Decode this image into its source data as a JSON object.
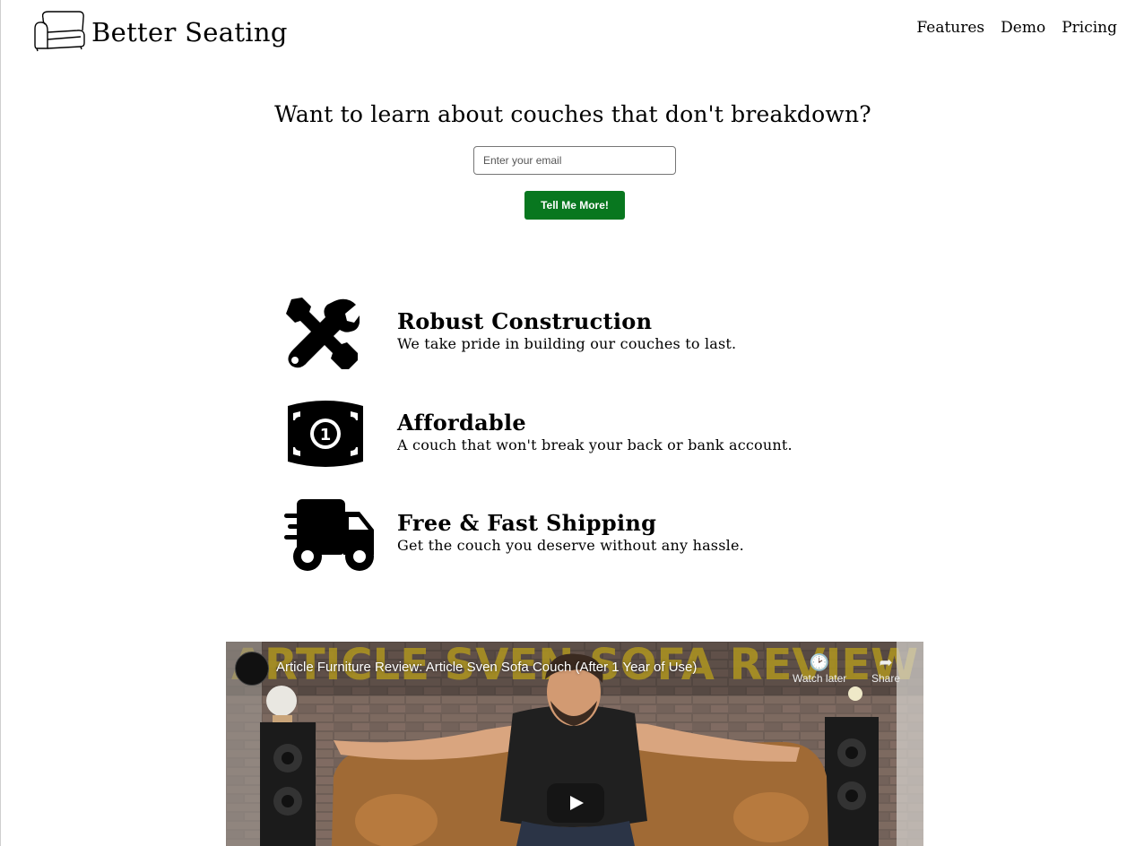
{
  "brand": {
    "name": "Better Seating",
    "logo_icon": "couch-icon"
  },
  "nav": {
    "items": [
      "Features",
      "Demo",
      "Pricing"
    ]
  },
  "hero": {
    "heading": "Want to learn about couches that don't breakdown?",
    "email_placeholder": "Enter your email",
    "submit_label": "Tell Me More!"
  },
  "features": [
    {
      "icon": "tools-icon",
      "title": "Robust Construction",
      "description": "We take pride in building our couches to last."
    },
    {
      "icon": "money-bill-icon",
      "title": "Affordable",
      "description": "A couch that won't break your back or bank account."
    },
    {
      "icon": "shipping-truck-icon",
      "title": "Free & Fast Shipping",
      "description": "Get the couch you deserve without any hassle."
    }
  ],
  "video": {
    "title": "Article Furniture Review: Article Sven Sofa Couch (After 1 Year of Use)",
    "watch_later_label": "Watch later",
    "share_label": "Share",
    "banner_text": "ARTICLE SVEN SOFA REVIEW"
  },
  "colors": {
    "submit_button": "#08771f",
    "text": "#000000",
    "background": "#ffffff"
  }
}
